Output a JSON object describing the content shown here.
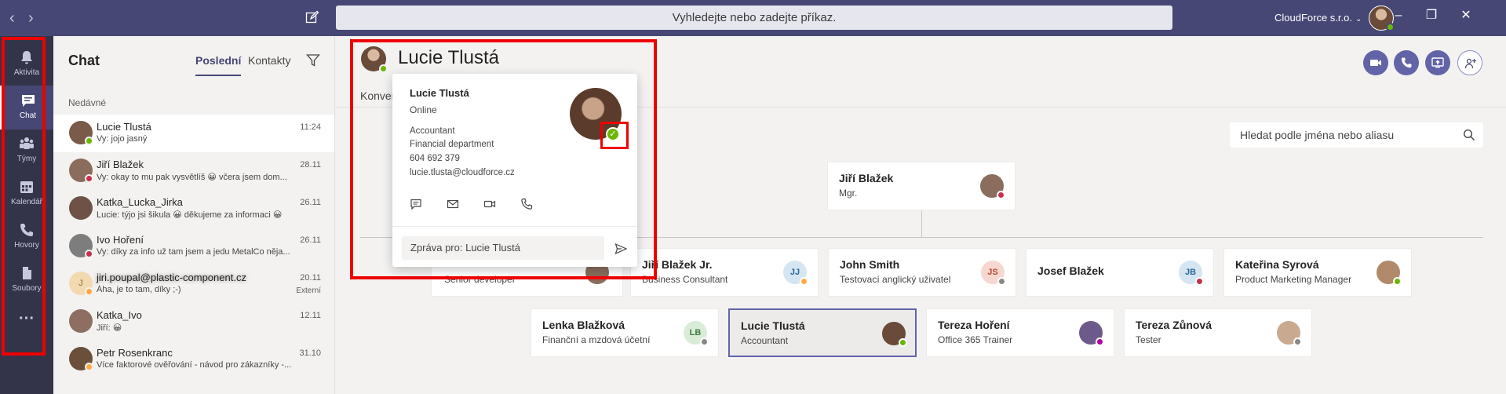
{
  "titlebar": {
    "back_icon": "‹",
    "forward_icon": "›",
    "search_placeholder": "Vyhledejte nebo zadejte příkaz.",
    "tenant": "CloudForce s.r.o.",
    "tenant_chevron": "⌄",
    "minimize": "–",
    "maximize": "❐",
    "close": "✕"
  },
  "rail": {
    "items": [
      {
        "label": "Aktivita",
        "icon": "bell-icon"
      },
      {
        "label": "Chat",
        "icon": "chat-icon"
      },
      {
        "label": "Týmy",
        "icon": "teams-icon"
      },
      {
        "label": "Kalendář",
        "icon": "calendar-icon"
      },
      {
        "label": "Hovory",
        "icon": "phone-icon"
      },
      {
        "label": "Soubory",
        "icon": "files-icon"
      }
    ],
    "more": "···",
    "active": "Chat"
  },
  "chatpane": {
    "title": "Chat",
    "tabs": [
      "Poslední",
      "Kontakty"
    ],
    "section": "Nedávné",
    "items": [
      {
        "name": "Lucie Tlustá",
        "preview": "Vy: jojo jasný",
        "time": "11:24",
        "status": "#6bb700",
        "avatar": "#7a5a48"
      },
      {
        "name": "Jiří Blažek",
        "preview": "Vy: okay to mu pak vysvětlíš 😀 včera jsem dom...",
        "time": "28.11",
        "status": "#c4314b",
        "avatar": "#8a6d5c"
      },
      {
        "name": "Katka_Lucka_Jirka",
        "preview": "Lucie: týjo jsi šikula 😀 děkujeme za informaci 😀",
        "time": "26.11",
        "status": "",
        "avatar": "#6e5245"
      },
      {
        "name": "Ivo Hoření",
        "preview": "Vy: díky za info už tam jsem a jedu MetalCo něja...",
        "time": "26.11",
        "status": "#c4314b",
        "avatar": "#7d7d7d"
      },
      {
        "name": "jiri.poupal@plastic-component.cz",
        "preview": "Áha, je to tam, díky ;-)",
        "time": "20.11",
        "status": "#ffaa44",
        "avatar": "#f2d9b0",
        "initial": "J",
        "external": "Externí"
      },
      {
        "name": "Katka_Ivo",
        "preview": "Jiří: 😀",
        "time": "12.11",
        "status": "",
        "avatar": "#8d6e60"
      },
      {
        "name": "Petr Rosenkranc",
        "preview": "Více faktorové ověřování - návod pro zákazníky -...",
        "time": "31.10",
        "status": "#ffaa44",
        "avatar": "#6b4f3a"
      }
    ]
  },
  "header": {
    "name": "Lucie Tlustá",
    "tab": "Konver"
  },
  "org_search": {
    "placeholder": "Hledat podle jména nebo aliasu"
  },
  "org": {
    "manager": {
      "name": "Jiří Blažek",
      "role": "Mgr."
    },
    "peers": [
      {
        "name": "Jiří Blažek Jr.",
        "role": "Business Consultant",
        "initials": "JJ",
        "bg": "#d5e6f2",
        "fg": "#2b6a9b",
        "status": "#ffaa44"
      },
      {
        "name": "John Smith",
        "role": "Testovací anglický uživatel",
        "initials": "JS",
        "bg": "#f7d8d0",
        "fg": "#b54a2f",
        "status": "#8a8886"
      },
      {
        "name": "Josef Blažek",
        "role": "",
        "initials": "JB",
        "bg": "#d5e6f2",
        "fg": "#2b6a9b",
        "status": "#c4314b"
      },
      {
        "name": "Kateřina Syrová",
        "role": "Product Marketing Manager",
        "initials": "",
        "bg": "#b08a6a",
        "fg": "#fff",
        "status": "#6bb700"
      }
    ],
    "hidden_role": "Senior developer",
    "reports": [
      {
        "name": "Lenka Blažková",
        "role": "Finanční a mzdová účetní",
        "initials": "LB",
        "bg": "#d9ecd8",
        "fg": "#3b7a3a",
        "status": "#8a8886"
      },
      {
        "name": "Lucie Tlustá",
        "role": "Accountant",
        "initials": "",
        "bg": "#6a4a38",
        "fg": "#fff",
        "status": "#6bb700"
      },
      {
        "name": "Tereza Hoření",
        "role": "Office 365 Trainer",
        "initials": "",
        "bg": "#6e5a8a",
        "fg": "#fff",
        "status": "#b4009e"
      },
      {
        "name": "Tereza Zůnová",
        "role": "Tester",
        "initials": "",
        "bg": "#c9a98f",
        "fg": "#fff",
        "status": "#8a8886"
      }
    ]
  },
  "popup": {
    "name": "Lucie Tlustá",
    "status": "Online",
    "job": "Accountant",
    "department": "Financial department",
    "phone": "604 692 379",
    "email": "lucie.tlusta@cloudforce.cz",
    "status_glyph": "✓",
    "message_placeholder": "Zpráva pro: Lucie Tlustá"
  }
}
